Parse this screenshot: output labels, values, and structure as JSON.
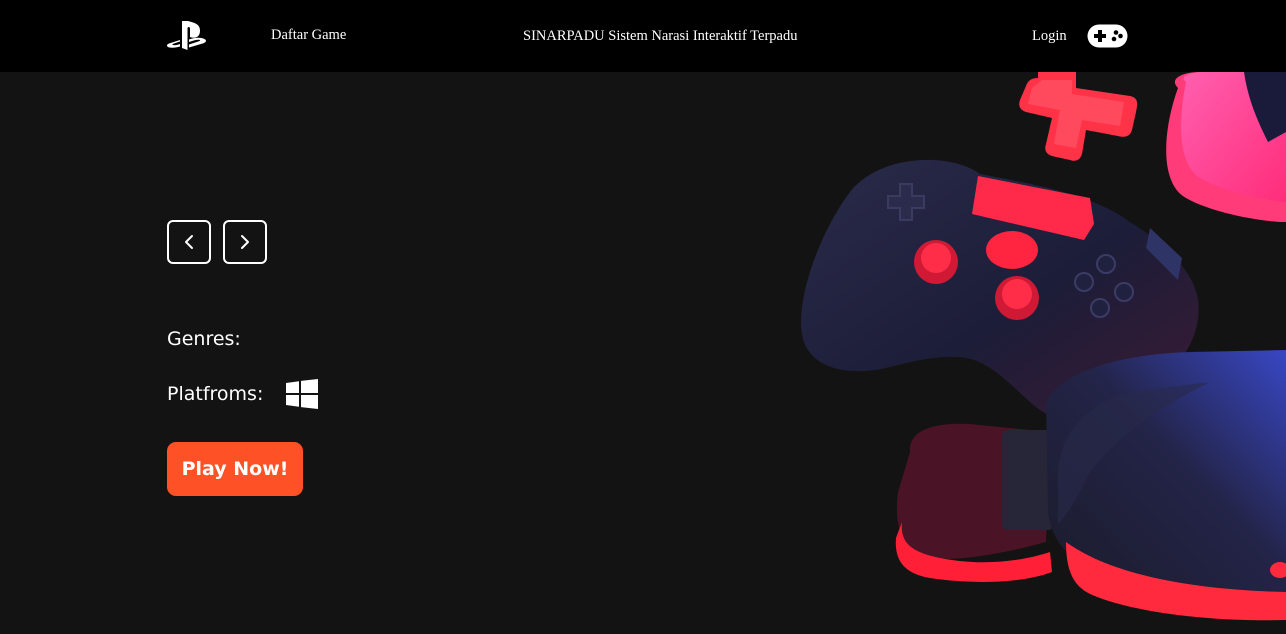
{
  "nav": {
    "logo_icon": "playstation-logo-icon",
    "games_label": "Daftar Game",
    "site_title": "SINARPADU Sistem Narasi Interaktif Terpadu",
    "login_label": "Login",
    "gamepad_icon": "gamepad-icon"
  },
  "hero": {
    "prev_icon": "chevron-left-icon",
    "next_icon": "chevron-right-icon",
    "genres_label": "Genres:",
    "platforms_label": "Platfroms:",
    "platform_icons": [
      "windows-icon"
    ],
    "play_label": "Play Now!",
    "art_icon": "game-controller-vr-headset-illustration"
  },
  "colors": {
    "background": "#131313",
    "navbar": "#000000",
    "accent": "#ff5126",
    "text": "#ffffff"
  }
}
